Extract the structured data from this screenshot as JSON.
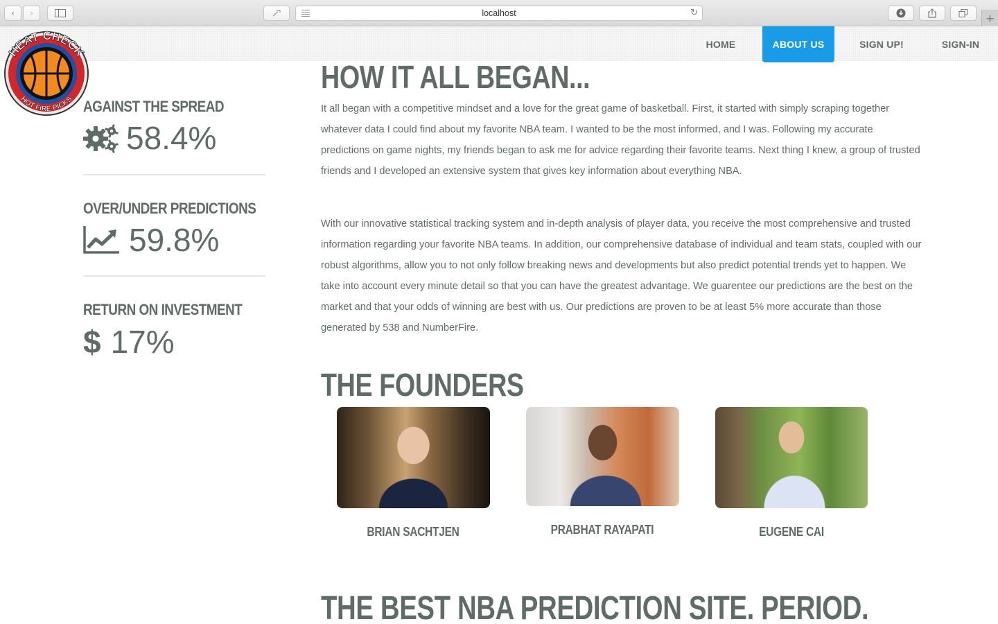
{
  "browser": {
    "url": "localhost"
  },
  "nav": {
    "items": [
      {
        "label": "HOME",
        "active": false
      },
      {
        "label": "ABOUT US",
        "active": true
      },
      {
        "label": "SIGN UP!",
        "active": false
      },
      {
        "label": "SIGN-IN",
        "active": false
      }
    ],
    "active_color": "#1a9be8"
  },
  "logo": {
    "top_text": "HEAT CHECK",
    "bottom_text": "HOT FIRE PICKS"
  },
  "stats": [
    {
      "title": "AGAINST THE SPREAD",
      "icon": "gears-icon",
      "value": "58.4%"
    },
    {
      "title": "OVER/UNDER PREDICTIONS",
      "icon": "line-chart-icon",
      "value": "59.8%"
    },
    {
      "title": "RETURN ON INVESTMENT",
      "icon": "dollar-icon",
      "value": "17%"
    }
  ],
  "main": {
    "heading": "HOW IT ALL BEGAN...",
    "paragraph1": "It all began with a competitive mindset and a love for the great game of basketball. First, it started with simply scraping together whatever data I could find about my favorite NBA team. I wanted to be the most informed, and I was. Following my accurate predictions on game nights, my friends began to ask me for advice regarding their favorite teams. Next thing I knew, a group of trusted friends and I developed an extensive system that gives key information about everything NBA.",
    "paragraph2": "With our innovative statistical tracking system and in-depth analysis of player data, you receive the most comprehensive and trusted information regarding your favorite NBA teams. In addition, our comprehensive database of individual and team stats, coupled with our robust algorithms, allow you to not only follow breaking news and developments but also predict potential trends yet to happen. We take into account every minute detail so that you can have the greatest advantage. We guarentee our predictions are the best on the market and that your odds of winning are best with us. Our predictions are proven to be at least 5% more accurate than those generated by 538 and NumberFire.",
    "founders_heading": "THE FOUNDERS",
    "founders": [
      {
        "name": "BRIAN SACHTJEN"
      },
      {
        "name": "PRABHAT RAYAPATI"
      },
      {
        "name": "EUGENE CAI"
      }
    ],
    "bottom_heading": "THE BEST NBA PREDICTION SITE. PERIOD."
  }
}
